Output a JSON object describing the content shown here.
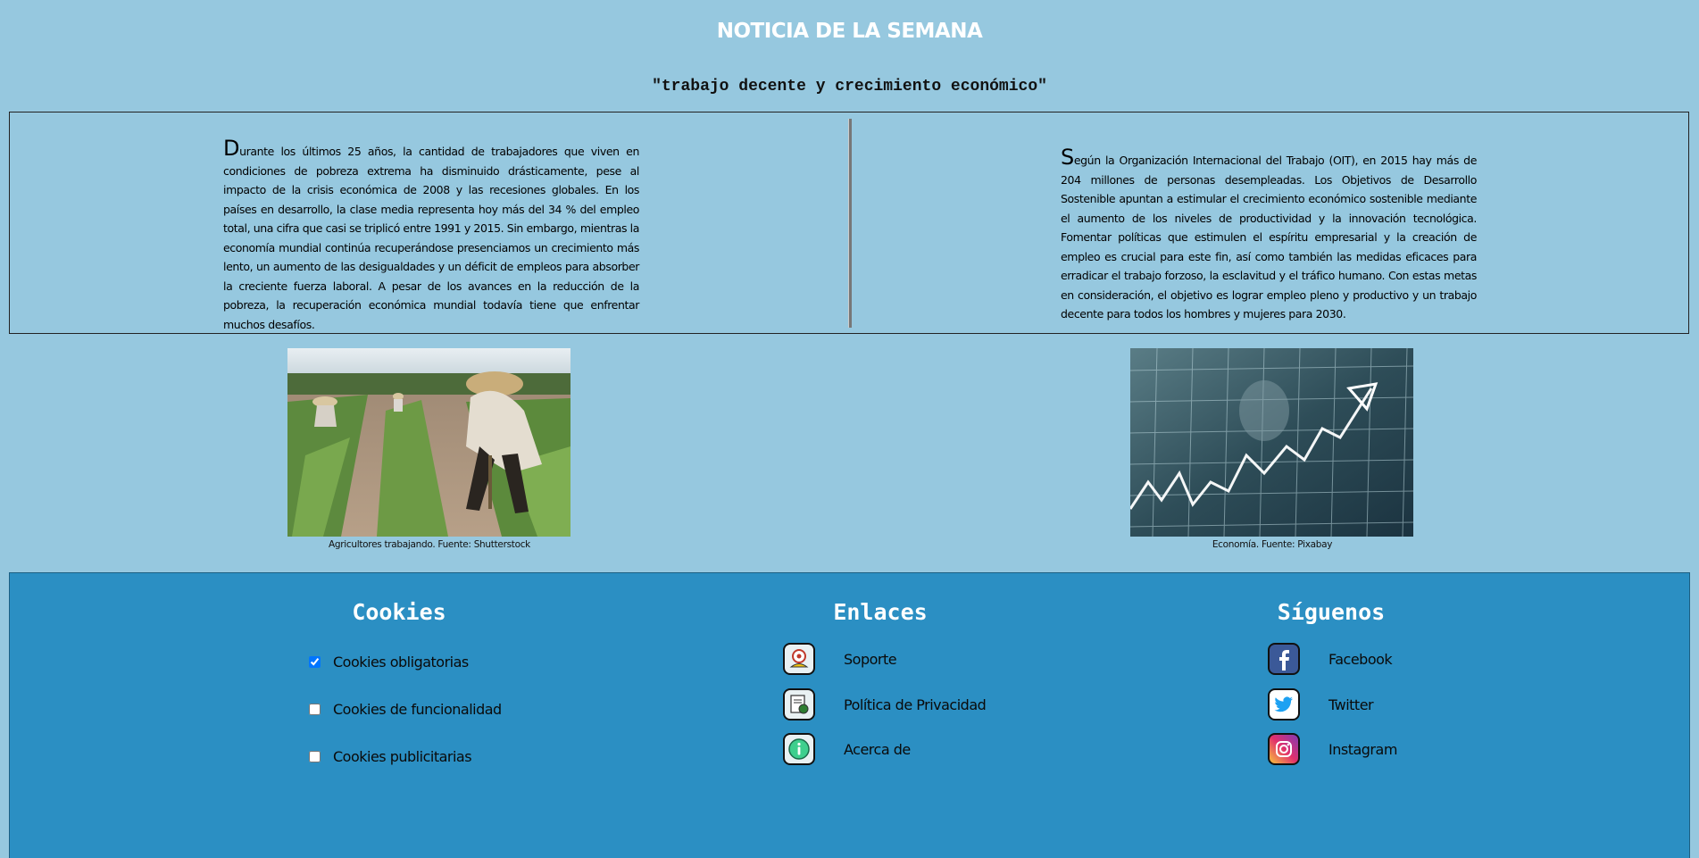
{
  "header": {
    "title": "NOTICIA DE LA SEMANA",
    "subtitle": "\"trabajo decente y crecimiento económico\""
  },
  "article": {
    "left": {
      "dropcap": "D",
      "text": "urante los últimos 25 años, la cantidad de trabajadores que viven en condiciones de pobreza extrema ha disminuido drásticamente, pese al impacto de la crisis económica de 2008 y las recesiones globales. En los países en desarrollo, la clase media representa hoy más del 34 % del empleo total, una cifra que casi se triplicó entre 1991 y 2015. Sin embargo, mientras la economía mundial continúa recuperándose presenciamos un crecimiento más lento, un aumento de las desigualdades y un déficit de empleos para absorber la creciente fuerza laboral. A pesar de los avances en la reducción de la pobreza, la recuperación económica mundial todavía tiene que enfrentar muchos desafíos."
    },
    "right": {
      "dropcap": "S",
      "text": "egún la Organización Internacional del Trabajo (OIT), en 2015 hay más de 204 millones de personas desempleadas. Los Objetivos de Desarrollo Sostenible apuntan a estimular el crecimiento económico sostenible mediante el aumento de los niveles de productividad y la innovación tecnológica. Fomentar políticas que estimulen el espíritu empresarial y la creación de empleo es crucial para este fin, así como también las medidas eficaces para erradicar el trabajo forzoso, la esclavitud y el tráfico humano. Con estas metas en consideración, el objetivo es lograr empleo pleno y productivo y un trabajo decente para todos los hombres y mujeres para 2030."
    }
  },
  "images": [
    {
      "caption": "Agricultores trabajando. Fuente: Shutterstock",
      "icon": "farmers-photo"
    },
    {
      "caption": "Economía. Fuente: Pixabay",
      "icon": "economy-chart-photo"
    }
  ],
  "footer": {
    "cookies": {
      "heading": "Cookies",
      "items": [
        {
          "label": "Cookies obligatorias",
          "checked": true
        },
        {
          "label": "Cookies de funcionalidad",
          "checked": false
        },
        {
          "label": "Cookies publicitarias",
          "checked": false
        }
      ]
    },
    "links": {
      "heading": "Enlaces",
      "items": [
        {
          "label": "Soporte",
          "icon": "support-icon"
        },
        {
          "label": "Política de Privacidad",
          "icon": "privacy-policy-icon"
        },
        {
          "label": "Acerca de",
          "icon": "info-icon"
        }
      ]
    },
    "social": {
      "heading": "Síguenos",
      "items": [
        {
          "label": "Facebook",
          "icon": "facebook-icon",
          "color": "#3b5998"
        },
        {
          "label": "Twitter",
          "icon": "twitter-icon",
          "color": "#1da1f2"
        },
        {
          "label": "Instagram",
          "icon": "instagram-icon",
          "color": "#d6249f"
        }
      ]
    }
  },
  "colors": {
    "background": "#96c8df",
    "footer": "#2b8fc3",
    "title": "#ffffff"
  }
}
